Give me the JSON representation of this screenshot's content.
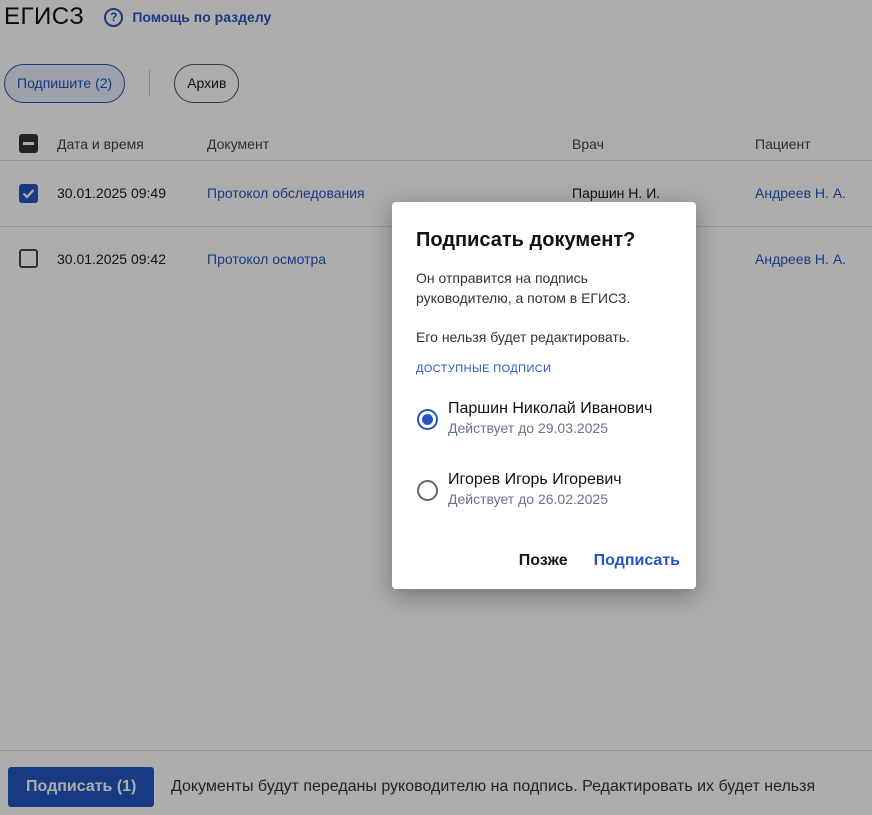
{
  "header": {
    "title": "ЕГИСЗ",
    "help_icon": "question-circle-icon",
    "help_label": "Помощь по разделу"
  },
  "tabs": [
    {
      "label": "Подпишите (2)",
      "active": true
    },
    {
      "label": "Архив",
      "active": false
    }
  ],
  "table": {
    "columns": [
      "Дата и время",
      "Документ",
      "Врач",
      "Пациент"
    ],
    "rows": [
      {
        "checked": true,
        "datetime": "30.01.2025 09:49",
        "document": "Протокол обследования",
        "doctor": "Паршин Н. И.",
        "patient": "Андреев Н. А."
      },
      {
        "checked": false,
        "datetime": "30.01.2025 09:42",
        "document": "Протокол осмотра",
        "doctor": "",
        "patient": "Андреев Н. А."
      }
    ]
  },
  "bottom_bar": {
    "sign_button": "Подписать (1)",
    "note": "Документы будут переданы руководителю на подпись. Редактировать их будет нельзя"
  },
  "dialog": {
    "title": "Подписать документ?",
    "text_1": "Он отправится на подпись руководителю, а потом в ЕГИСЗ.",
    "text_2": "Его нельзя будет редактировать.",
    "section_label": "ДОСТУПНЫЕ ПОДПИСИ",
    "signatures": [
      {
        "name": "Паршин Николай Иванович",
        "valid": "Действует до 29.03.2025",
        "selected": true
      },
      {
        "name": "Игорев Игорь Игоревич",
        "valid": "Действует до 26.02.2025",
        "selected": false
      }
    ],
    "later_button": "Позже",
    "sign_button": "Подписать"
  },
  "colors": {
    "accent": "#2456c0",
    "scrim": "rgba(0,0,0,0.32)",
    "secondary_text": "#66758f"
  }
}
